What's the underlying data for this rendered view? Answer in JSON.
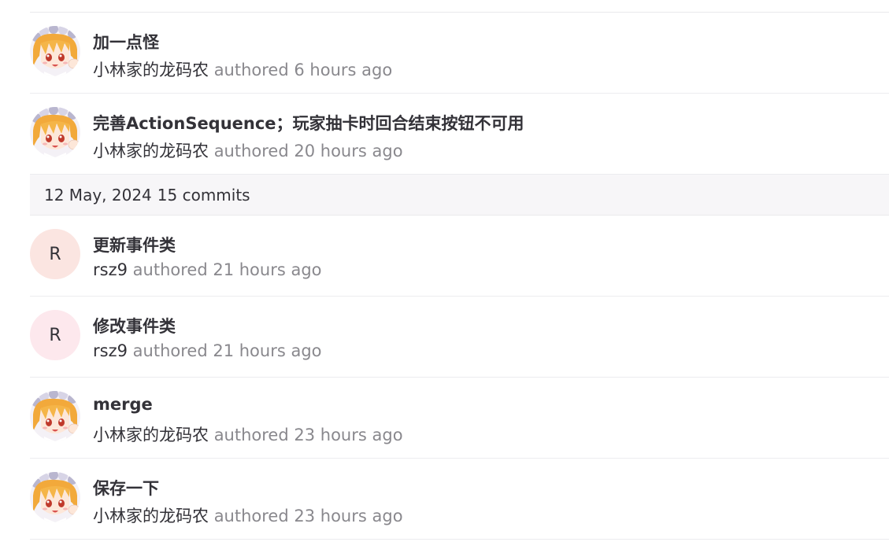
{
  "commits_before": [
    {
      "title": "加一点怪",
      "author": "小林家的龙码农",
      "authored": "authored",
      "time": "6 hours ago",
      "avatar": "anime-avatar"
    },
    {
      "title": "完善ActionSequence；玩家抽卡时回合结束按钮不可用",
      "author": "小林家的龙码农",
      "authored": "authored",
      "time": "20 hours ago",
      "avatar": "anime-avatar"
    }
  ],
  "day_group": {
    "date": "12 May, 2024",
    "count": "15 commits"
  },
  "commits_after": [
    {
      "title": "更新事件类",
      "author": "rsz9",
      "authored": "authored",
      "time": "21 hours ago",
      "avatar_letter": "R",
      "avatar_color": "#fbe5e1"
    },
    {
      "title": "修改事件类",
      "author": "rsz9",
      "authored": "authored",
      "time": "21 hours ago",
      "avatar_letter": "R",
      "avatar_color": "#fde8ed"
    },
    {
      "title": "merge",
      "author": "小林家的龙码农",
      "authored": "authored",
      "time": "23 hours ago",
      "avatar": "anime-avatar"
    },
    {
      "title": "保存一下",
      "author": "小林家的龙码农",
      "authored": "authored",
      "time": "23 hours ago",
      "avatar": "anime-avatar"
    }
  ]
}
